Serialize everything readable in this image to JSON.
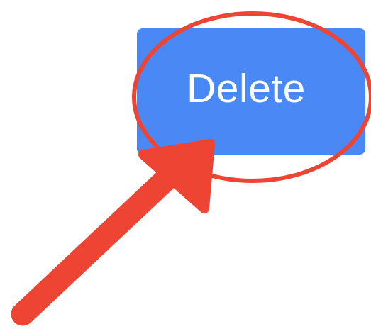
{
  "button": {
    "label": "Delete",
    "background_color": "#4a89f5",
    "text_color": "#ffffff"
  },
  "annotation": {
    "color": "#ee4433",
    "icons": [
      "circle-highlight",
      "arrow"
    ]
  }
}
